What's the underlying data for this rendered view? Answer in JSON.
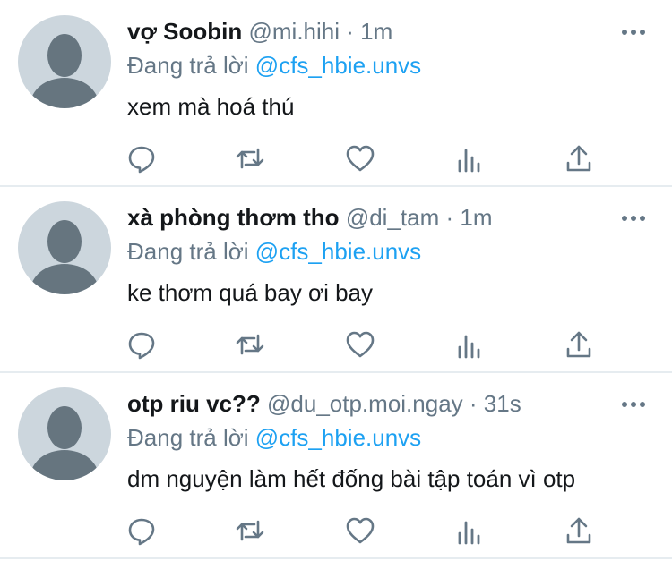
{
  "tweets": [
    {
      "display_name": "vợ Soobin",
      "handle": "@mi.hihi",
      "separator": "·",
      "time": "1m",
      "replying_prefix": "Đang trả lời",
      "replying_to": "@cfs_hbie.unvs",
      "text": "xem mà hoá thú"
    },
    {
      "display_name": "xà phòng thơm tho",
      "handle": "@di_tam",
      "separator": "·",
      "time": "1m",
      "replying_prefix": "Đang trả lời",
      "replying_to": "@cfs_hbie.unvs",
      "text": "ke thơm quá bay ơi bay"
    },
    {
      "display_name": "otp riu vc??",
      "handle": "@du_otp.moi.ngay",
      "separator": "·",
      "time": "31s",
      "replying_prefix": "Đang trả lời",
      "replying_to": "@cfs_hbie.unvs",
      "text": "dm nguyện làm hết đống bài tập toán vì otp"
    }
  ],
  "icons": {
    "reply": "reply-icon",
    "retweet": "retweet-icon",
    "like": "like-icon",
    "stats": "stats-icon",
    "share": "share-icon",
    "more": "more-icon"
  },
  "colors": {
    "text_primary": "#14171a",
    "text_secondary": "#657786",
    "link": "#1da1f2",
    "avatar_bg": "#ccd6dd",
    "avatar_fg": "#66757f",
    "divider": "#e6ecf0"
  }
}
